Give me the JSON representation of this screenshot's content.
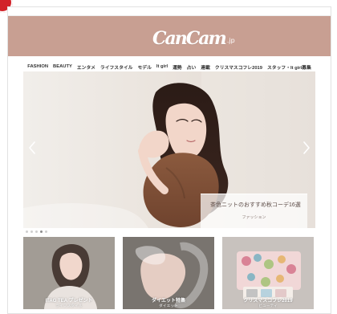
{
  "brand": {
    "logo_text": "CanCam",
    "logo_suffix": ".jp",
    "header_color": "#c89f92"
  },
  "nav": {
    "items": [
      "FASHION",
      "BEAUTY",
      "エンタメ",
      "ライフスタイル",
      "モデル",
      "It girl",
      "運勢",
      "占い",
      "連載",
      "クリスマスコフレ2019",
      "スタッフ・It girl募集"
    ]
  },
  "hero": {
    "caption_title": "茶色ニットのおすすめ秋コーデ16選",
    "caption_tag": "ファッション",
    "prev_icon": "chevron-left-icon",
    "next_icon": "chevron-right-icon",
    "active_dot_index": 4,
    "dots_count": 5
  },
  "cards": [
    {
      "title": "ITAG TEA プレゼント",
      "tag": "ライフスタイル"
    },
    {
      "title": "ダイエット特集",
      "tag": "ダイエット"
    },
    {
      "title": "クリスマスコフレ2019",
      "tag": "ビューティ"
    }
  ],
  "colors": {
    "badge_red": "#d2232a",
    "caption_bg": "rgba(255,255,255,0.72)"
  }
}
